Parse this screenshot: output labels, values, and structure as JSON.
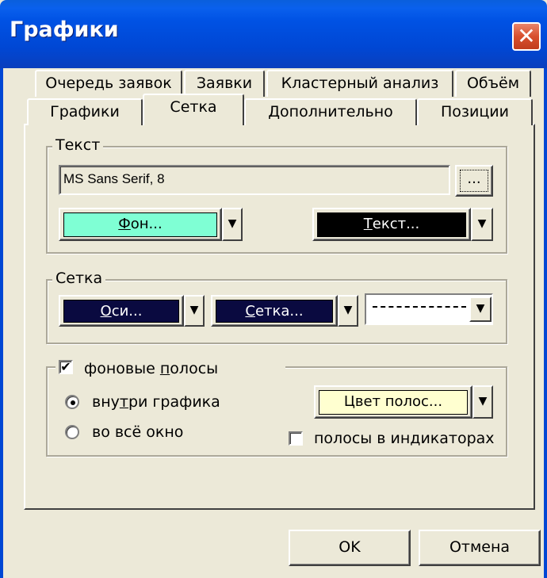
{
  "window": {
    "title": "Графики",
    "close_glyph": "✕"
  },
  "tabs_row1": [
    "Очередь заявок",
    "Заявки",
    "Кластерный анализ",
    "Объём"
  ],
  "tabs_row2": [
    "Графики",
    "Сетка",
    "Дополнительно",
    "Позиции"
  ],
  "active_tab": "Сетка",
  "text_group": {
    "legend": "Текст",
    "font_value": "MS Sans Serif, 8",
    "font_button": "...",
    "background_button": {
      "prefix": "Ф",
      "rest": "он...",
      "color": "#7fffd4",
      "text_color": "#000000"
    },
    "text_button": {
      "prefix": "Т",
      "rest": "екст...",
      "color": "#000000",
      "text_color": "#ffffff"
    },
    "dropdown_arrow": "▼"
  },
  "grid_group": {
    "legend": "Сетка",
    "axes_button": {
      "prefix": "О",
      "rest": "си...",
      "color": "#0a0a40",
      "text_color": "#ffffff"
    },
    "grid_button": {
      "prefix": "С",
      "rest": "етка...",
      "color": "#0a0a40",
      "text_color": "#ffffff"
    },
    "line_style": "dashed"
  },
  "stripes_group": {
    "checkbox_label_pre": "фоновые ",
    "checkbox_label_u": "п",
    "checkbox_label_post": "олосы",
    "checkbox_checked": true,
    "radio_inside_pre": "вну",
    "radio_inside_u": "т",
    "radio_inside_post": "ри графика",
    "radio_whole": "во всё окно",
    "radio_selected": "inside",
    "stripe_color_button": {
      "label": "Цвет полос...",
      "color": "#ffffd0"
    },
    "indicator_checkbox_label": "полосы в индикаторах",
    "indicator_checked": false
  },
  "footer": {
    "ok": "OK",
    "cancel": "Отмена"
  }
}
